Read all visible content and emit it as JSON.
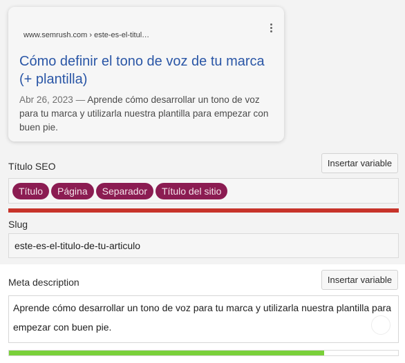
{
  "preview": {
    "url": "www.semrush.com › este-es-el-titul…",
    "title": "Cómo definir el tono de voz de tu marca (+ plantilla)",
    "date": "Abr 26, 2023",
    "separator": " — ",
    "description": "Aprende cómo desarrollar un tono de voz para tu marca y utilizarla nuestra plantilla para empezar con buen pie."
  },
  "seo_title": {
    "label": "Título SEO",
    "insert_button": "Insertar variable",
    "chips": [
      "Título",
      "Página",
      "Separador",
      "Título del sitio"
    ],
    "progress": 1.0,
    "progress_color": "#c7332a"
  },
  "slug": {
    "label": "Slug",
    "value": "este-es-el-titulo-de-tu-articulo"
  },
  "meta_description": {
    "label": "Meta description",
    "insert_button": "Insertar variable",
    "value": "Aprende cómo desarrollar un tono de voz para tu marca y utilizarla nuestra plantilla para empezar con buen pie.",
    "progress": 0.81,
    "progress_color": "#7ad03a"
  },
  "colors": {
    "link": "#2a56a6",
    "chip": "#8b1c52"
  },
  "icons": {
    "preview_menu": "kebab-menu-icon"
  }
}
